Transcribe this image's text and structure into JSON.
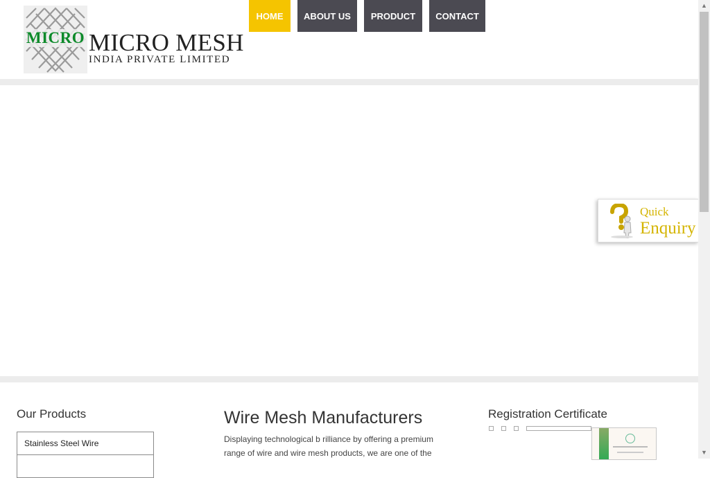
{
  "logo": {
    "text": "MICRO",
    "brand_name": "MICRO MESH",
    "brand_sub": "INDIA PRIVATE LIMITED"
  },
  "nav": [
    "HOME",
    "ABOUT US",
    "PRODUCT",
    "CONTACT"
  ],
  "quick_enquiry": {
    "line1": "Quick",
    "line2": "Enquiry"
  },
  "products": {
    "title": "Our Products",
    "items": [
      "Stainless Steel Wire",
      ""
    ]
  },
  "main": {
    "title": "Wire Mesh Manufacturers",
    "text": "Displaying technological b rilliance by offering a premium range of wire and wire mesh products, we are one of the"
  },
  "certificate": {
    "title": "Registration Certificate"
  },
  "colors": {
    "accent": "#f5c400",
    "nav_bg": "#4b4a52",
    "logo_green": "#0d8a2a"
  }
}
